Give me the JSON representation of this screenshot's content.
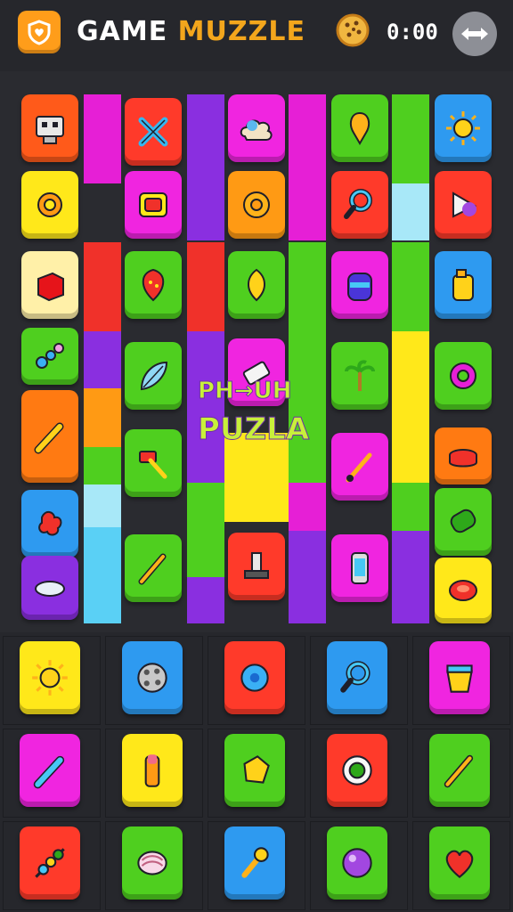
{
  "header": {
    "title_part1": "GAME",
    "title_part2": "MUZZLE",
    "timer": "0:00",
    "app_icon": "shield-heart-icon",
    "coin_icon": "cookie-icon",
    "back_icon": "double-arrow-icon"
  },
  "overlay": {
    "line1": "PH→UH",
    "line2": "PUZLA"
  },
  "colors": {
    "background": "#2a2b30",
    "accent": "#f3a61c",
    "orange": "#ff7a12",
    "red": "#f0312a",
    "green": "#4fcf1f",
    "blue": "#2e9af0",
    "magenta": "#e61fd6",
    "yellow": "#ffe81a",
    "purple": "#8a2fe0",
    "lightblue": "#a8e8f8"
  },
  "board_tiles": [
    {
      "name": "robot-block-icon",
      "color": "#ff5a1a"
    },
    {
      "name": "wrench-cross-icon",
      "color": "#ff3a2a"
    },
    {
      "name": "cloud-icon",
      "color": "#f025e0"
    },
    {
      "name": "balloon-icon",
      "color": "#4fcf1f"
    },
    {
      "name": "sun-icon",
      "color": "#2e9af0"
    },
    {
      "name": "gear-sun-icon",
      "color": "#ffe81a"
    },
    {
      "name": "red-button-icon",
      "color": "#f025e0"
    },
    {
      "name": "ring-icon",
      "color": "#ff9a14"
    },
    {
      "name": "magnifier-icon",
      "color": "#ff3a2a"
    },
    {
      "name": "cone-icon",
      "color": "#ff3a2a"
    },
    {
      "name": "red-box-icon",
      "color": "#fff0a8"
    },
    {
      "name": "strawberry-icon",
      "color": "#4fcf1f"
    },
    {
      "name": "lemon-icon",
      "color": "#4fcf1f"
    },
    {
      "name": "potion-jar-icon",
      "color": "#f025e0"
    },
    {
      "name": "bottle-icon",
      "color": "#2e9af0"
    },
    {
      "name": "bead-chain-icon",
      "color": "#4fcf1f"
    },
    {
      "name": "feather-leaf-icon",
      "color": "#4fcf1f"
    },
    {
      "name": "eraser-icon",
      "color": "#f025e0"
    },
    {
      "name": "palm-tree-icon",
      "color": "#4fcf1f"
    },
    {
      "name": "cog-icon",
      "color": "#4fcf1f"
    },
    {
      "name": "crayon-icon",
      "color": "#ff7a12"
    },
    {
      "name": "hammer-icon",
      "color": "#4fcf1f"
    },
    {
      "name": "brush-icon",
      "color": "#f025e0"
    },
    {
      "name": "bowl-icon",
      "color": "#ff7a12"
    },
    {
      "name": "splat-icon",
      "color": "#2e9af0"
    },
    {
      "name": "pepper-icon",
      "color": "#4fcf1f"
    },
    {
      "name": "puck-icon",
      "color": "#8a2fe0"
    },
    {
      "name": "pencil-icon",
      "color": "#4fcf1f"
    },
    {
      "name": "stamp-icon",
      "color": "#ff3a2a"
    },
    {
      "name": "phone-icon",
      "color": "#f025e0"
    },
    {
      "name": "red-pill-icon",
      "color": "#ffe81a"
    }
  ],
  "tray_tiles": [
    {
      "name": "sun-icon",
      "color": "#ffe81a"
    },
    {
      "name": "cookie-icon",
      "color": "#2e9af0"
    },
    {
      "name": "gear-blue-icon",
      "color": "#ff3a2a"
    },
    {
      "name": "magnifier-icon",
      "color": "#2e9af0"
    },
    {
      "name": "bucket-icon",
      "color": "#f025e0"
    },
    {
      "name": "marker-icon",
      "color": "#f025e0"
    },
    {
      "name": "lipstick-icon",
      "color": "#ffe81a"
    },
    {
      "name": "cube-icon",
      "color": "#4fcf1f"
    },
    {
      "name": "flower-icon",
      "color": "#ff3a2a"
    },
    {
      "name": "pencil-icon",
      "color": "#4fcf1f"
    },
    {
      "name": "skewer-icon",
      "color": "#ff3a2a"
    },
    {
      "name": "shell-icon",
      "color": "#4fcf1f"
    },
    {
      "name": "ice-cream-icon",
      "color": "#2e9af0"
    },
    {
      "name": "orb-icon",
      "color": "#4fcf1f"
    },
    {
      "name": "heart-icon",
      "color": "#4fcf1f"
    }
  ]
}
